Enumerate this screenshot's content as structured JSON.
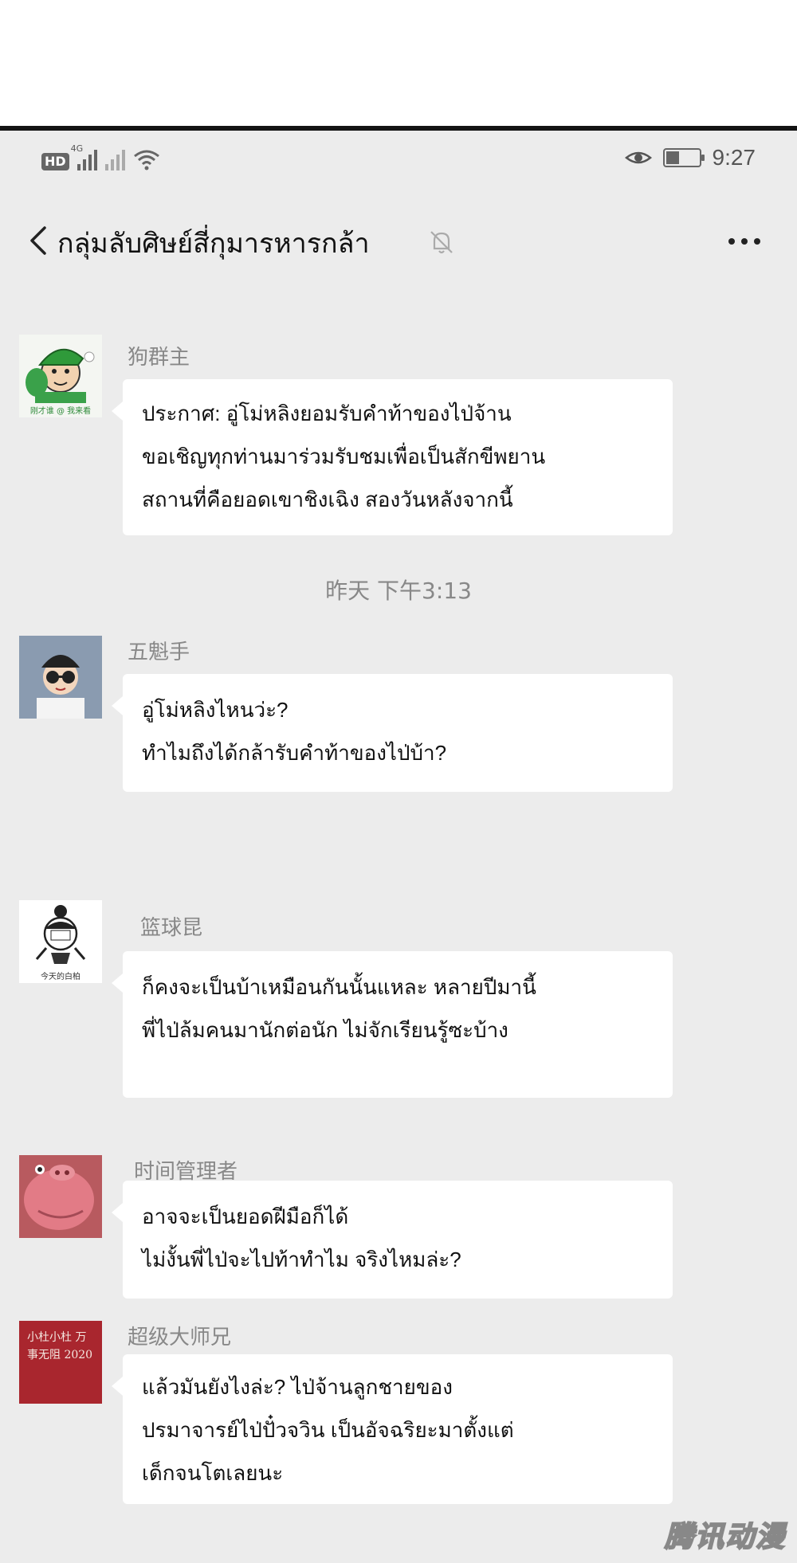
{
  "status_bar": {
    "hd_label": "HD",
    "network_label": "4G",
    "time": "9:27",
    "battery_level": 0.4,
    "icons": [
      "hd-icon",
      "signal-icon",
      "signal-weak-icon",
      "wifi-icon",
      "eye-icon",
      "battery-icon"
    ]
  },
  "nav": {
    "title": "กลุ่มลับศิษย์สี่กุมารหารกล้า",
    "icons": [
      "back-icon",
      "mute-bell-icon",
      "more-icon"
    ]
  },
  "chat": {
    "timestamp": "昨天 下午3:13",
    "messages": [
      {
        "sender": "狗群主",
        "avatar_caption": "刚才谁 @ 我来看",
        "lines": [
          "ประกาศ: อู่โม่หลิงยอมรับคำท้าของไป่จ้าน",
          "ขอเชิญทุกท่านมาร่วมรับชมเพื่อเป็นสักขีพยาน",
          "สถานที่คือยอดเขาชิงเฉิง สองวันหลังจากนี้"
        ]
      },
      {
        "sender": "五魁手",
        "avatar_caption": "",
        "lines": [
          "อู่โม่หลิงไหนว่ะ?",
          "ทำไมถึงได้กล้ารับคำท้าของไป่บ้า?"
        ]
      },
      {
        "sender": "篮球昆",
        "avatar_caption": "今天的白柏",
        "lines": [
          "ก็คงจะเป็นบ้าเหมือนกันนั้นแหละ หลายปีมานี้",
          "พี่ไป่ล้มคนมานักต่อนัก ไม่จักเรียนรู้ซะบ้าง"
        ]
      },
      {
        "sender": "时间管理者",
        "avatar_caption": "",
        "lines": [
          "อาจจะเป็นยอดฝีมือก็ได้",
          "ไม่งั้นพี่ไป่จะไปท้าทำไม จริงไหมล่ะ?"
        ]
      },
      {
        "sender": "超级大师兄",
        "avatar_caption": "小杜小杜 万事无阻 2020",
        "lines": [
          "แล้วมันยังไงล่ะ? ไป่จ้านลูกชายของ",
          "ปรมาจารย์ไป่ปั๋วจวิน เป็นอัจฉริยะมาตั้งแต่",
          "เด็กจนโตเลยนะ"
        ]
      }
    ]
  },
  "watermark": "腾讯动漫",
  "colors": {
    "screen_bg": "#ececec",
    "bubble_bg": "#ffffff",
    "name_text": "#888888",
    "rule": "#141414"
  }
}
